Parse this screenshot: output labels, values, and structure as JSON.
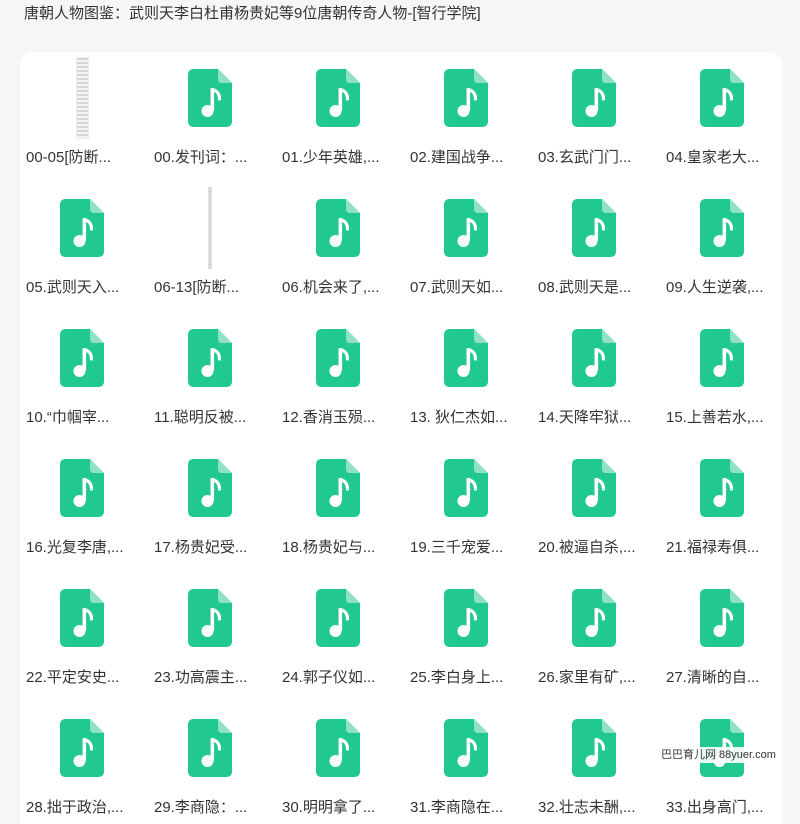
{
  "page": {
    "title": "唐朝人物图鉴：武则天李白杜甫杨贵妃等9位唐朝传奇人物-[智行学院]"
  },
  "colors": {
    "background": "#f5f6f8",
    "card": "#ffffff",
    "audio_icon": "#22c98e",
    "audio_icon_fold": "#8fe2c4",
    "text": "#333333"
  },
  "files": [
    {
      "name": "00-05[防断...",
      "type": "image",
      "icon": "image-thumbnail"
    },
    {
      "name": "00.发刊词：...",
      "type": "audio",
      "icon": "music-file-icon"
    },
    {
      "name": "01.少年英雄,...",
      "type": "audio",
      "icon": "music-file-icon"
    },
    {
      "name": "02.建国战争...",
      "type": "audio",
      "icon": "music-file-icon"
    },
    {
      "name": "03.玄武门门...",
      "type": "audio",
      "icon": "music-file-icon"
    },
    {
      "name": "04.皇家老大...",
      "type": "audio",
      "icon": "music-file-icon"
    },
    {
      "name": "05.武则天入...",
      "type": "audio",
      "icon": "music-file-icon"
    },
    {
      "name": "06-13[防断...",
      "type": "image",
      "icon": "image-thumbnail"
    },
    {
      "name": "06.机会来了,...",
      "type": "audio",
      "icon": "music-file-icon"
    },
    {
      "name": "07.武则天如...",
      "type": "audio",
      "icon": "music-file-icon"
    },
    {
      "name": "08.武则天是...",
      "type": "audio",
      "icon": "music-file-icon"
    },
    {
      "name": "09.人生逆袭,...",
      "type": "audio",
      "icon": "music-file-icon"
    },
    {
      "name": "10.“巾帼宰...",
      "type": "audio",
      "icon": "music-file-icon"
    },
    {
      "name": "11.聪明反被...",
      "type": "audio",
      "icon": "music-file-icon"
    },
    {
      "name": "12.香消玉殒...",
      "type": "audio",
      "icon": "music-file-icon"
    },
    {
      "name": "13. 狄仁杰如...",
      "type": "audio",
      "icon": "music-file-icon"
    },
    {
      "name": "14.天降牢狱...",
      "type": "audio",
      "icon": "music-file-icon"
    },
    {
      "name": "15.上善若水,...",
      "type": "audio",
      "icon": "music-file-icon"
    },
    {
      "name": "16.光复李唐,...",
      "type": "audio",
      "icon": "music-file-icon"
    },
    {
      "name": "17.杨贵妃受...",
      "type": "audio",
      "icon": "music-file-icon"
    },
    {
      "name": "18.杨贵妃与...",
      "type": "audio",
      "icon": "music-file-icon"
    },
    {
      "name": "19.三千宠爱...",
      "type": "audio",
      "icon": "music-file-icon"
    },
    {
      "name": "20.被逼自杀,...",
      "type": "audio",
      "icon": "music-file-icon"
    },
    {
      "name": "21.福禄寿俱...",
      "type": "audio",
      "icon": "music-file-icon"
    },
    {
      "name": "22.平定安史...",
      "type": "audio",
      "icon": "music-file-icon"
    },
    {
      "name": "23.功高震主...",
      "type": "audio",
      "icon": "music-file-icon"
    },
    {
      "name": "24.郭子仪如...",
      "type": "audio",
      "icon": "music-file-icon"
    },
    {
      "name": "25.李白身上...",
      "type": "audio",
      "icon": "music-file-icon"
    },
    {
      "name": "26.家里有矿,...",
      "type": "audio",
      "icon": "music-file-icon"
    },
    {
      "name": "27.清晰的自...",
      "type": "audio",
      "icon": "music-file-icon"
    },
    {
      "name": "28.拙于政治,...",
      "type": "audio",
      "icon": "music-file-icon"
    },
    {
      "name": "29.李商隐：...",
      "type": "audio",
      "icon": "music-file-icon"
    },
    {
      "name": "30.明明拿了...",
      "type": "audio",
      "icon": "music-file-icon"
    },
    {
      "name": "31.李商隐在...",
      "type": "audio",
      "icon": "music-file-icon"
    },
    {
      "name": "32.壮志未酬,...",
      "type": "audio",
      "icon": "music-file-icon"
    },
    {
      "name": "33.出身高门,...",
      "type": "audio",
      "icon": "music-file-icon"
    }
  ],
  "watermark": "巴巴育儿网 88yuer.com"
}
